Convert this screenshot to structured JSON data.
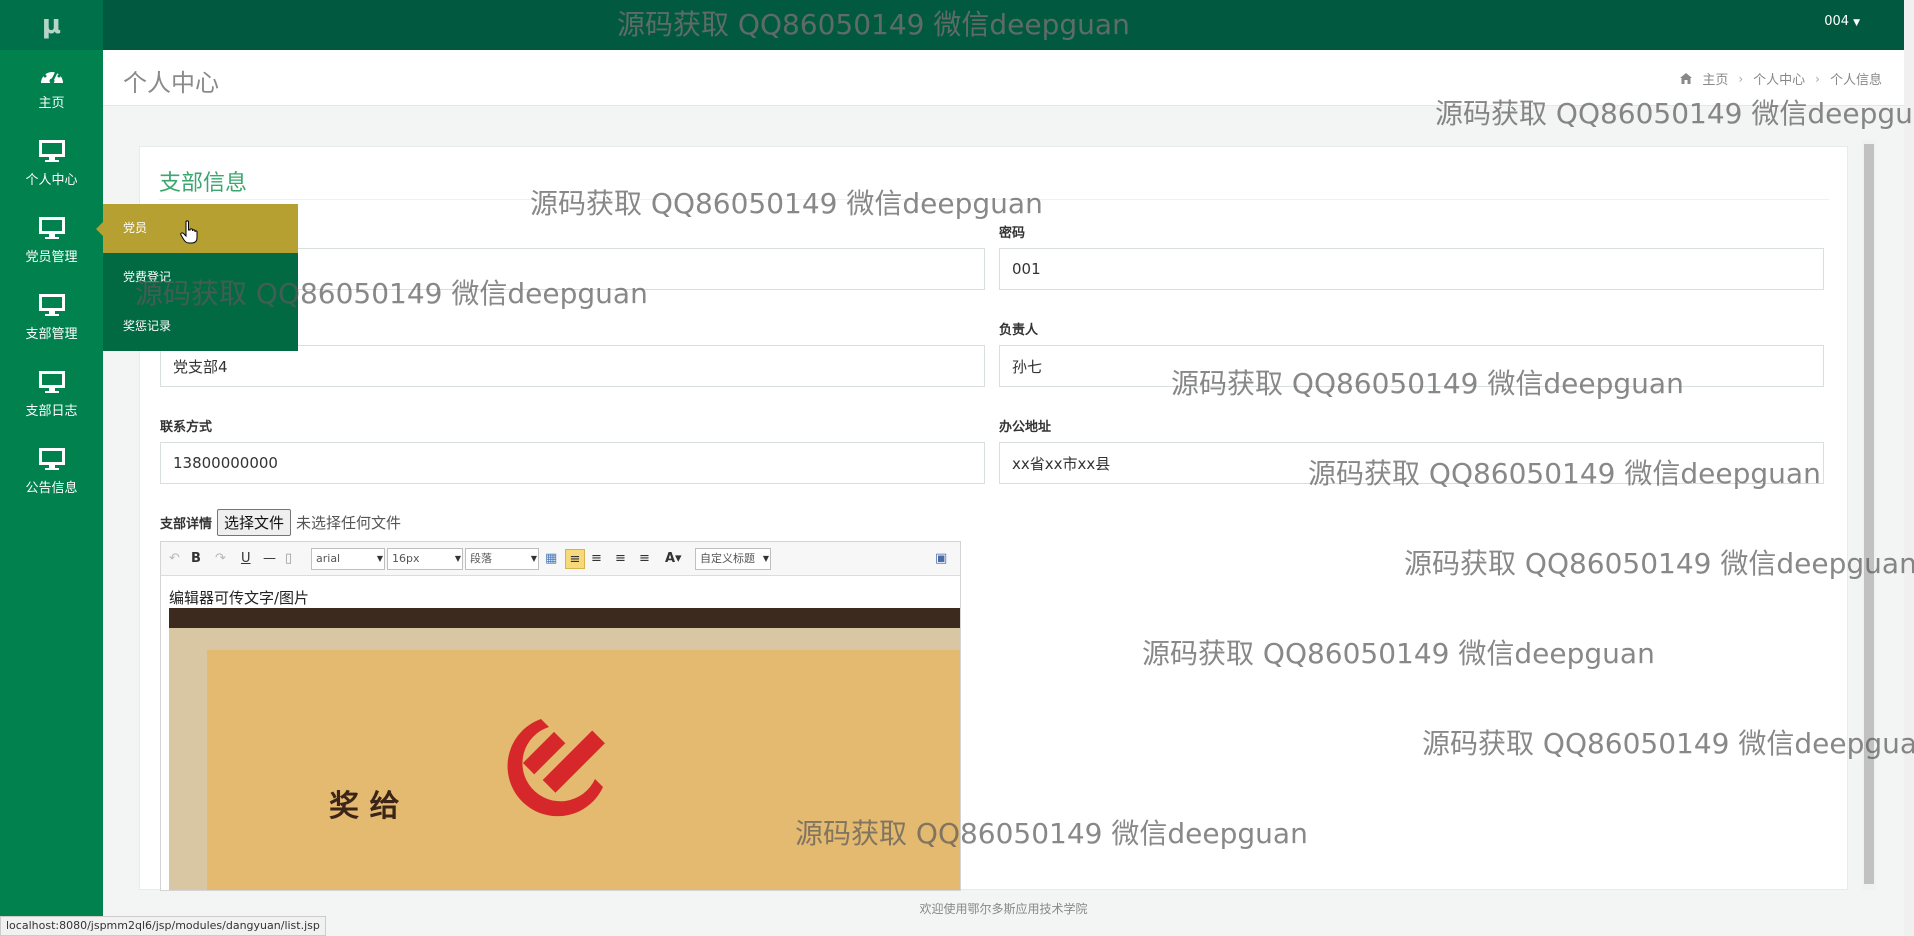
{
  "app": {
    "logo": "μ",
    "user": "004",
    "footer": "欢迎使用鄂尔多斯应用技术学院",
    "status_url": "localhost:8080/jspmm2ql6/jsp/modules/dangyuan/list.jsp"
  },
  "sidebar": {
    "items": [
      {
        "label": "主页",
        "icon": "dashboard-icon"
      },
      {
        "label": "个人中心",
        "icon": "monitor-icon"
      },
      {
        "label": "党员管理",
        "icon": "monitor-icon"
      },
      {
        "label": "支部管理",
        "icon": "monitor-icon"
      },
      {
        "label": "支部日志",
        "icon": "monitor-icon"
      },
      {
        "label": "公告信息",
        "icon": "monitor-icon"
      }
    ],
    "flyout": [
      "党员",
      "党费登记",
      "奖惩记录"
    ]
  },
  "header": {
    "title": "个人中心",
    "breadcrumb": [
      "主页",
      "个人中心",
      "个人信息"
    ]
  },
  "card": {
    "title": "支部信息",
    "fields": {
      "password": {
        "label": "密码",
        "value": "001"
      },
      "branch_name": {
        "value": "党支部4"
      },
      "leader": {
        "label": "负责人",
        "value": "孙七"
      },
      "contact": {
        "label": "联系方式",
        "value": "13800000000"
      },
      "address": {
        "label": "办公地址",
        "value": "xx省xx市xx县"
      }
    },
    "details_label": "支部详情",
    "file_button": "选择文件",
    "file_status": "未选择任何文件"
  },
  "editor": {
    "font": "arial",
    "size": "16px",
    "paragraph": "段落",
    "custom_title": "自定义标题",
    "text": "编辑器可传文字/图片",
    "image_text": "奖 给",
    "colors": {
      "frame": "#3c2a1f",
      "paper": "#e4b970",
      "emblem": "#d6282a"
    }
  },
  "watermark": "源码获取 QQ86050149 微信deepguan",
  "colors": {
    "topbar": "#015a3f",
    "sidebar": "#00814e",
    "flyout": "#016a43",
    "flyout_active": "#b7a032",
    "accent": "#3aa76f"
  }
}
